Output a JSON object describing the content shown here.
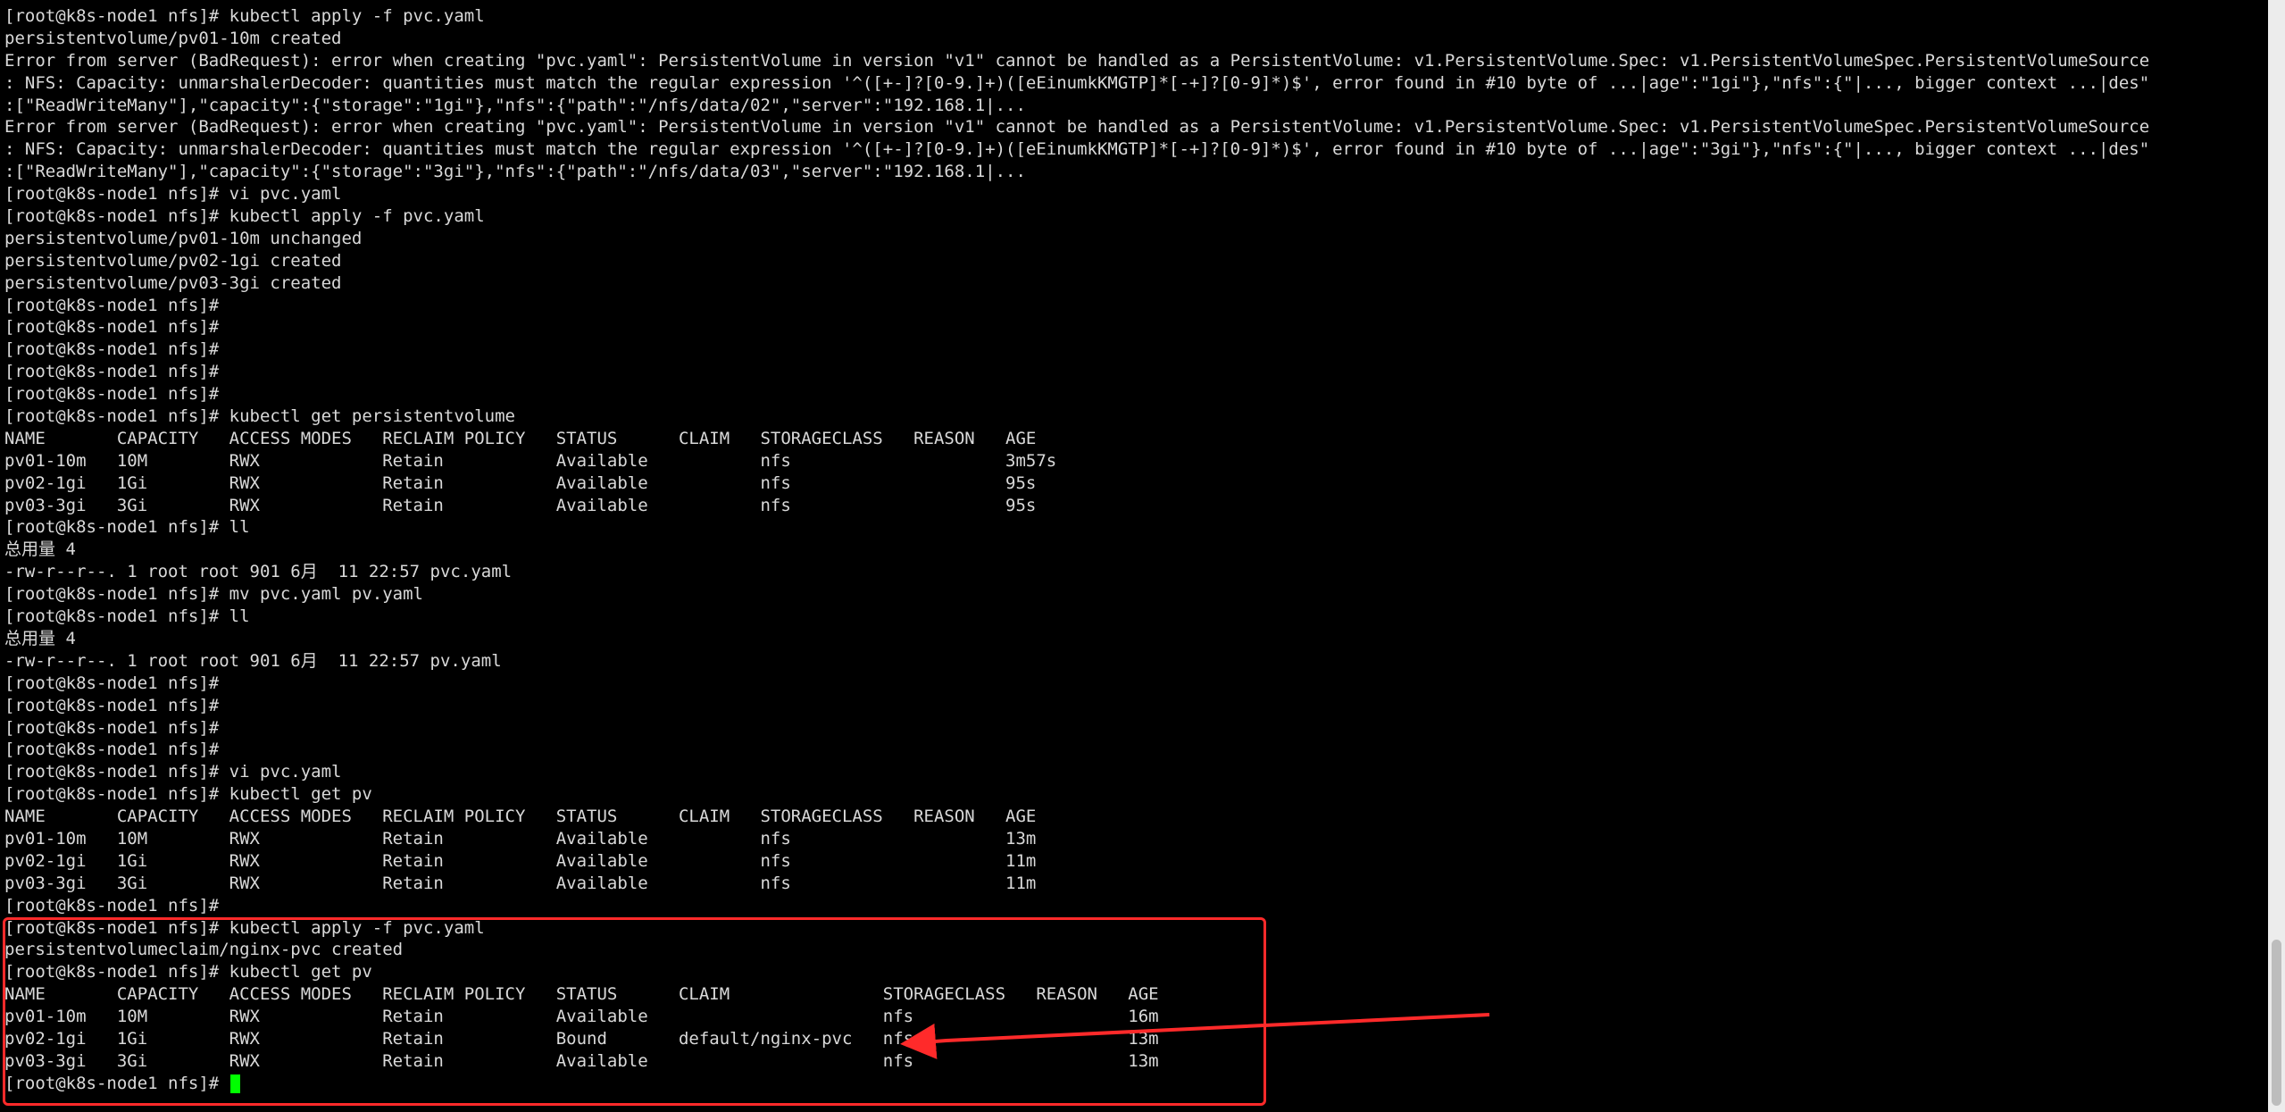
{
  "terminal": {
    "lines": [
      "[root@k8s-node1 nfs]# kubectl apply -f pvc.yaml",
      "persistentvolume/pv01-10m created",
      "Error from server (BadRequest): error when creating \"pvc.yaml\": PersistentVolume in version \"v1\" cannot be handled as a PersistentVolume: v1.PersistentVolume.Spec: v1.PersistentVolumeSpec.PersistentVolumeSource",
      ": NFS: Capacity: unmarshalerDecoder: quantities must match the regular expression '^([+-]?[0-9.]+)([eEinumkKMGTP]*[-+]?[0-9]*)$', error found in #10 byte of ...|age\":\"1gi\"},\"nfs\":{\"|..., bigger context ...|des\"",
      ":[\"ReadWriteMany\"],\"capacity\":{\"storage\":\"1gi\"},\"nfs\":{\"path\":\"/nfs/data/02\",\"server\":\"192.168.1|...",
      "Error from server (BadRequest): error when creating \"pvc.yaml\": PersistentVolume in version \"v1\" cannot be handled as a PersistentVolume: v1.PersistentVolume.Spec: v1.PersistentVolumeSpec.PersistentVolumeSource",
      ": NFS: Capacity: unmarshalerDecoder: quantities must match the regular expression '^([+-]?[0-9.]+)([eEinumkKMGTP]*[-+]?[0-9]*)$', error found in #10 byte of ...|age\":\"3gi\"},\"nfs\":{\"|..., bigger context ...|des\"",
      ":[\"ReadWriteMany\"],\"capacity\":{\"storage\":\"3gi\"},\"nfs\":{\"path\":\"/nfs/data/03\",\"server\":\"192.168.1|...",
      "[root@k8s-node1 nfs]# vi pvc.yaml",
      "[root@k8s-node1 nfs]# kubectl apply -f pvc.yaml",
      "persistentvolume/pv01-10m unchanged",
      "persistentvolume/pv02-1gi created",
      "persistentvolume/pv03-3gi created",
      "[root@k8s-node1 nfs]#",
      "[root@k8s-node1 nfs]#",
      "[root@k8s-node1 nfs]#",
      "[root@k8s-node1 nfs]#",
      "[root@k8s-node1 nfs]#",
      "[root@k8s-node1 nfs]# kubectl get persistentvolume",
      "NAME       CAPACITY   ACCESS MODES   RECLAIM POLICY   STATUS      CLAIM   STORAGECLASS   REASON   AGE",
      "pv01-10m   10M        RWX            Retain           Available           nfs                     3m57s",
      "pv02-1gi   1Gi        RWX            Retain           Available           nfs                     95s",
      "pv03-3gi   3Gi        RWX            Retain           Available           nfs                     95s",
      "[root@k8s-node1 nfs]# ll",
      "总用量 4",
      "-rw-r--r--. 1 root root 901 6月  11 22:57 pvc.yaml",
      "[root@k8s-node1 nfs]# mv pvc.yaml pv.yaml",
      "[root@k8s-node1 nfs]# ll",
      "总用量 4",
      "-rw-r--r--. 1 root root 901 6月  11 22:57 pv.yaml",
      "[root@k8s-node1 nfs]#",
      "[root@k8s-node1 nfs]#",
      "[root@k8s-node1 nfs]#",
      "[root@k8s-node1 nfs]#",
      "[root@k8s-node1 nfs]# vi pvc.yaml",
      "[root@k8s-node1 nfs]# kubectl get pv",
      "NAME       CAPACITY   ACCESS MODES   RECLAIM POLICY   STATUS      CLAIM   STORAGECLASS   REASON   AGE",
      "pv01-10m   10M        RWX            Retain           Available           nfs                     13m",
      "pv02-1gi   1Gi        RWX            Retain           Available           nfs                     11m",
      "pv03-3gi   3Gi        RWX            Retain           Available           nfs                     11m",
      "[root@k8s-node1 nfs]#",
      "[root@k8s-node1 nfs]# kubectl apply -f pvc.yaml",
      "persistentvolumeclaim/nginx-pvc created",
      "[root@k8s-node1 nfs]# kubectl get pv",
      "NAME       CAPACITY   ACCESS MODES   RECLAIM POLICY   STATUS      CLAIM               STORAGECLASS   REASON   AGE",
      "pv01-10m   10M        RWX            Retain           Available                       nfs                     16m",
      "pv02-1gi   1Gi        RWX            Retain           Bound       default/nginx-pvc   nfs                     13m",
      "pv03-3gi   3Gi        RWX            Retain           Available                       nfs                     13m",
      "[root@k8s-node1 nfs]# "
    ]
  },
  "colors": {
    "background": "#000000",
    "text": "#d9d9d9",
    "cursor": "#00ff00",
    "annotation": "#ff2a2a",
    "scrollbar_track": "#ececec",
    "scrollbar_thumb": "#bdbdbd"
  },
  "scrollbar": {
    "position_fraction": 0.85
  }
}
